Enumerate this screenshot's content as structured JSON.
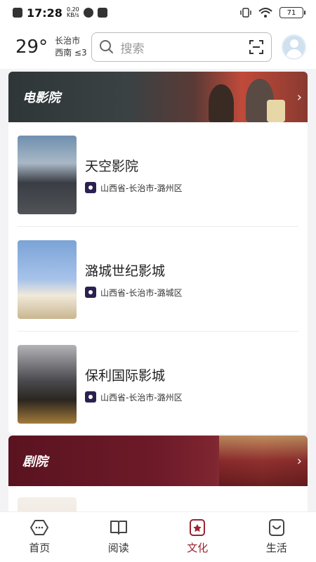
{
  "status": {
    "time": "17:28",
    "speed_value": "0.20",
    "speed_unit": "KB/s",
    "battery": "71"
  },
  "header": {
    "temperature": "29°",
    "city": "长治市",
    "wind": "西南 ≤3",
    "search_placeholder": "搜索"
  },
  "sections": [
    {
      "title": "电影院",
      "items": [
        {
          "name": "天空影院",
          "address": "山西省-长治市-潞州区"
        },
        {
          "name": "潞城世纪影城",
          "address": "山西省-长治市-潞城区"
        },
        {
          "name": "保利国际影城",
          "address": "山西省-长治市-潞州区"
        }
      ]
    },
    {
      "title": "剧院",
      "items": []
    }
  ],
  "nav": [
    {
      "label": "首页",
      "icon": "home-icon",
      "active": false
    },
    {
      "label": "阅读",
      "icon": "book-icon",
      "active": false
    },
    {
      "label": "文化",
      "icon": "culture-icon",
      "active": true
    },
    {
      "label": "生活",
      "icon": "life-icon",
      "active": false
    }
  ],
  "colors": {
    "accent": "#9a2430",
    "cinema_banner": "#2f3638",
    "theater_banner": "#5a1320"
  }
}
